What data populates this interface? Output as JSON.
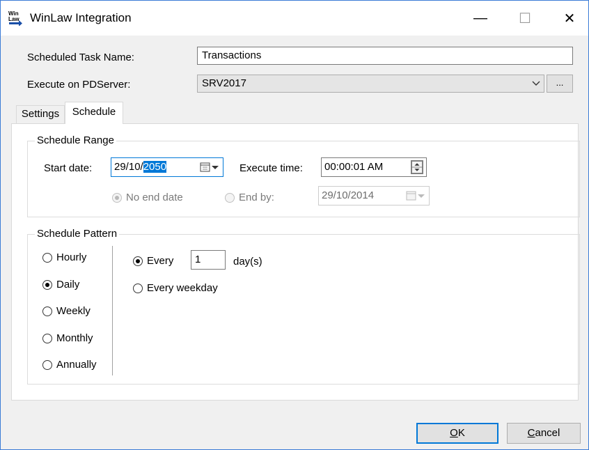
{
  "window": {
    "title": "WinLaw Integration",
    "minimize_glyph": "—",
    "maximize_glyph": "☐",
    "close_glyph": "✕",
    "icon": "winlaw-app-icon",
    "icon_text_top": "Win",
    "icon_text_bottom": "Law"
  },
  "form": {
    "task_name_label": "Scheduled Task Name:",
    "task_name_value": "Transactions",
    "server_label": "Execute on PDServer:",
    "server_value": "SRV2017",
    "browse_label": "..."
  },
  "tabs": [
    {
      "label": "Settings",
      "active": false
    },
    {
      "label": "Schedule",
      "active": true
    }
  ],
  "schedule_range": {
    "title": "Schedule Range",
    "start_date_label": "Start date:",
    "start_date_prefix": "29/10/",
    "start_date_selected": "2050",
    "execute_time_label": "Execute time:",
    "execute_time_value": "00:00:01 AM",
    "no_end_date_label": "No end date",
    "end_by_label": "End by:",
    "end_by_value": "29/10/2014"
  },
  "schedule_pattern": {
    "title": "Schedule Pattern",
    "frequencies": [
      {
        "label": "Hourly",
        "checked": false
      },
      {
        "label": "Daily",
        "checked": true
      },
      {
        "label": "Weekly",
        "checked": false
      },
      {
        "label": "Monthly",
        "checked": false
      },
      {
        "label": "Annually",
        "checked": false
      }
    ],
    "every_label": "Every",
    "every_value": "1",
    "days_label": "day(s)",
    "every_weekday_label": "Every weekday"
  },
  "buttons": {
    "ok_mnemonic": "O",
    "ok_rest": "K",
    "cancel_mnemonic": "C",
    "cancel_rest": "ancel"
  },
  "colors": {
    "accent": "#0078d7",
    "window_border": "#3b7bd6",
    "dialog_bg": "#f0f0f0"
  }
}
